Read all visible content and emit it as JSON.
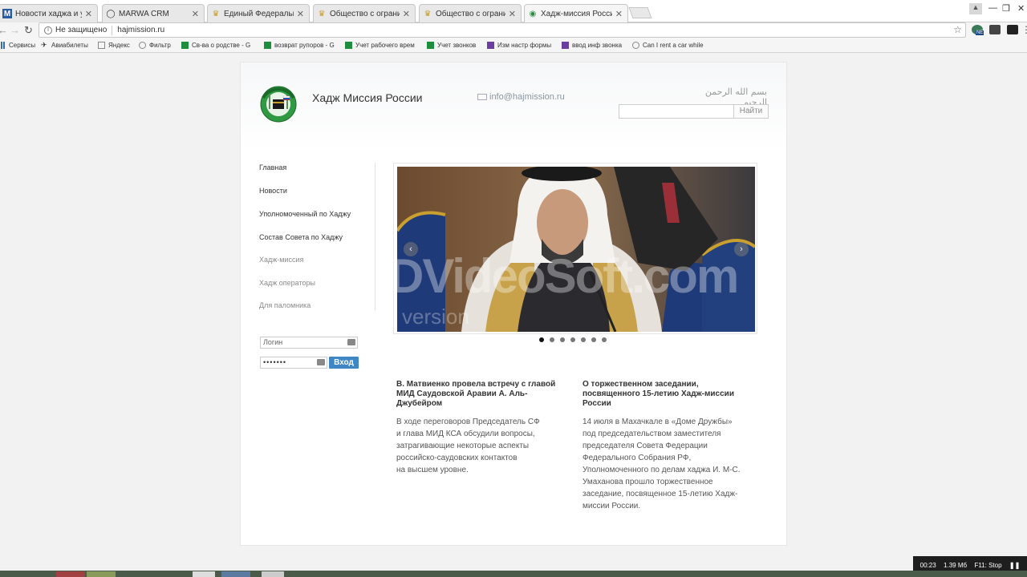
{
  "browser": {
    "tabs": [
      {
        "title": "Новости хаджа и умра г",
        "favicon": "M",
        "active": false
      },
      {
        "title": "MARWA CRM",
        "favicon": "globe-icon",
        "active": false
      },
      {
        "title": "Единый Федеральный р",
        "favicon": "emblem-icon",
        "active": false
      },
      {
        "title": "Общество с ограничени",
        "favicon": "emblem-icon",
        "active": false
      },
      {
        "title": "Общество с ограничени",
        "favicon": "emblem-icon",
        "active": false
      },
      {
        "title": "Хадж-миссия России",
        "favicon": "site-logo-icon",
        "active": true
      }
    ],
    "address": {
      "security_label": "Не защищено",
      "url": "hajmission.ru"
    },
    "bookmarks": [
      {
        "label": "Сервисы",
        "icon": "apps-icon"
      },
      {
        "label": "Авиабилеты",
        "icon": "plane-icon"
      },
      {
        "label": "Яндекс",
        "icon": "page-icon"
      },
      {
        "label": "Фильтр",
        "icon": "globe-icon"
      },
      {
        "label": "Св-ва о родстве - G",
        "icon": "sheets-icon"
      },
      {
        "label": "возврат рупоров - G",
        "icon": "sheets-icon"
      },
      {
        "label": "Учет рабочего врем",
        "icon": "sheets-icon"
      },
      {
        "label": "Учет звонков",
        "icon": "sheets-icon"
      },
      {
        "label": "Изм настр формы",
        "icon": "forms-icon"
      },
      {
        "label": "ввод инф звонка",
        "icon": "forms-icon"
      },
      {
        "label": "Can I rent a car while",
        "icon": "globe-icon"
      }
    ],
    "ext_badge": "NE"
  },
  "site": {
    "title": "Хадж Миссия России",
    "email": "info@hajmission.ru",
    "basmala": "بسم الله الرحمن الرحيم",
    "search": {
      "button": "Найти",
      "placeholder": ""
    },
    "nav": [
      {
        "label": "Главная",
        "muted": false
      },
      {
        "label": "Новости",
        "muted": false
      },
      {
        "label": "Уполномоченный по Хаджу",
        "muted": false
      },
      {
        "label": "Состав Совета по Хаджу",
        "muted": false
      },
      {
        "label": "Хадж-миссия",
        "muted": true
      },
      {
        "label": "Хадж операторы",
        "muted": true
      },
      {
        "label": "Для паломника",
        "muted": true
      }
    ],
    "login": {
      "login_placeholder": "Логин",
      "password_mask": "•••••••",
      "button": "Вход"
    },
    "slider": {
      "slide_count": 7,
      "active_index": 0,
      "watermark": "DVideoSoft.com",
      "watermark_sub": "version"
    },
    "news": [
      {
        "title": "В. Матвиенко провела встречу с главой МИД Саудовской Аравии А. Аль-Джубейром",
        "body": "В ходе переговоров Председатель СФ\nи глава МИД КСА обсудили вопросы,\nзатрагивающие некоторые аспекты\nроссийско-саудовских контактов\nна высшем уровне."
      },
      {
        "title": "О торжественном заседании, посвященного 15-летию Хадж-миссии России",
        "body": "14 июля в  Махачкале в «Доме Дружбы»\nпод председательством заместителя\nпредседателя Совета Федерации\nФедерального Собрания РФ,\nУполномоченного по делам хаджа И. М-С.\nУмаханова прошло торжественное\nзаседание, посвященное 15-летию Хадж-\nмиссии России."
      }
    ]
  },
  "recorder": {
    "time": "00:23",
    "size": "1.39 Мб",
    "hotkey": "F11: Stop"
  }
}
